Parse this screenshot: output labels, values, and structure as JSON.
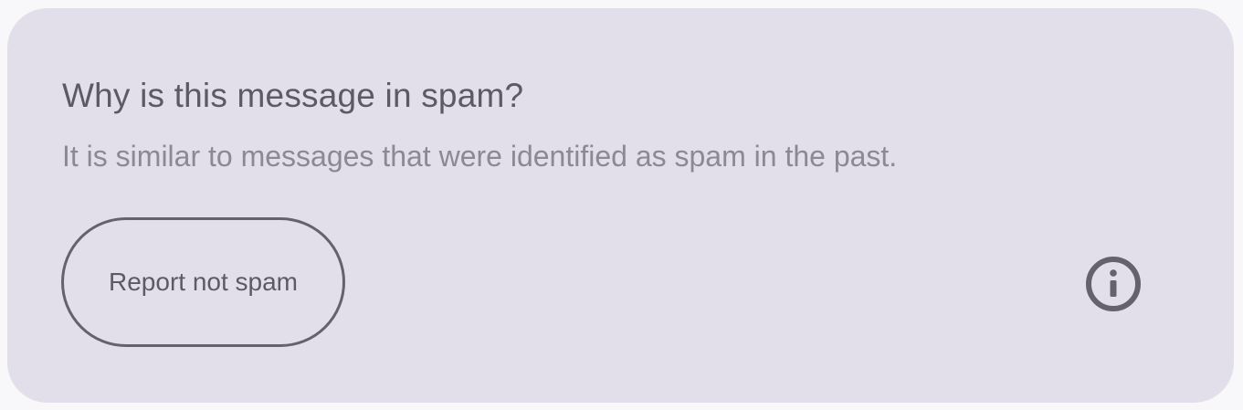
{
  "spam_notice": {
    "title": "Why is this message in spam?",
    "description": "It is similar to messages that were identified as spam in the past.",
    "report_button_label": "Report not spam",
    "info_icon": "info-icon"
  },
  "colors": {
    "card_background": "#e2dfeb",
    "title_text": "#5d5966",
    "description_text": "#8c8896",
    "outline": "#65616e"
  }
}
